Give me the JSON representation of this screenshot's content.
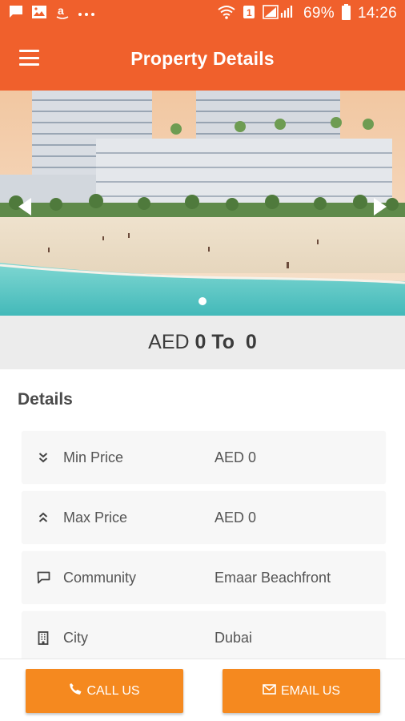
{
  "status_bar": {
    "battery": "69%",
    "time": "14:26",
    "notification_icons": [
      "chat-icon",
      "gallery-icon",
      "amazon-icon",
      "more-dots-icon"
    ],
    "system_icons": [
      "wifi-icon",
      "notification-badge-icon",
      "signal-icon",
      "battery-icon"
    ],
    "badge_text": "1"
  },
  "app_bar": {
    "title": "Property Details",
    "menu_icon": "hamburger-menu-icon"
  },
  "gallery": {
    "current_slide": 1,
    "total_slides": 1
  },
  "price": {
    "prefix": "AED ",
    "min": "0",
    "separator": " To ",
    "max": " 0"
  },
  "details": {
    "heading": "Details",
    "rows": [
      {
        "icon": "double-chevron-down-icon",
        "label": "Min Price",
        "value": "AED 0"
      },
      {
        "icon": "double-chevron-up-icon",
        "label": "Max Price",
        "value": "AED 0"
      },
      {
        "icon": "chat-bubble-icon",
        "label": "Community",
        "value": "Emaar Beachfront"
      },
      {
        "icon": "building-icon",
        "label": "City",
        "value": "Dubai"
      }
    ]
  },
  "actions": {
    "call_label": "CALL US",
    "email_label": "EMAIL US"
  },
  "colors": {
    "primary": "#f0602c",
    "button": "#f5891f",
    "band": "#ececec",
    "row_bg": "#f7f7f7"
  }
}
